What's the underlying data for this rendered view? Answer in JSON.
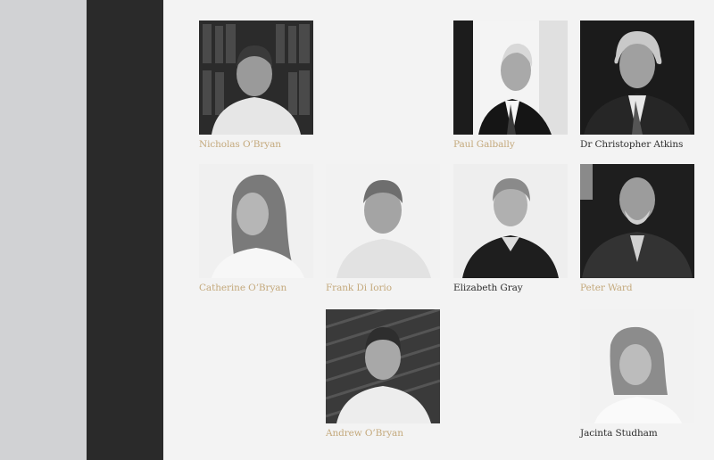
{
  "colors": {
    "accent_gold": "#c4a97c",
    "name_dark": "#2e2e2e",
    "rail_dark": "#2a2a2a",
    "side_grey": "#d1d2d4",
    "background": "#f3f3f3"
  },
  "team": [
    {
      "id": "nicholas",
      "name": "Nicholas O’Bryan",
      "name_color": "gold",
      "photo": "portrait-photo"
    },
    {
      "id": "paul",
      "name": "Paul Galbally",
      "name_color": "gold",
      "photo": "portrait-photo"
    },
    {
      "id": "christopher",
      "name": "Dr Christopher Atkins",
      "name_color": "dark",
      "photo": "portrait-photo"
    },
    {
      "id": "catherine",
      "name": "Catherine O’Bryan",
      "name_color": "gold",
      "photo": "portrait-photo"
    },
    {
      "id": "frank",
      "name": "Frank Di Iorio",
      "name_color": "gold",
      "photo": "portrait-photo"
    },
    {
      "id": "elizabeth",
      "name": "Elizabeth Gray",
      "name_color": "dark",
      "photo": "portrait-photo"
    },
    {
      "id": "peter",
      "name": "Peter Ward",
      "name_color": "gold",
      "photo": "portrait-photo"
    },
    {
      "id": "andrew",
      "name": "Andrew O’Bryan",
      "name_color": "gold",
      "photo": "portrait-photo"
    },
    {
      "id": "jacinta",
      "name": "Jacinta Studham",
      "name_color": "dark",
      "photo": "portrait-photo"
    }
  ]
}
